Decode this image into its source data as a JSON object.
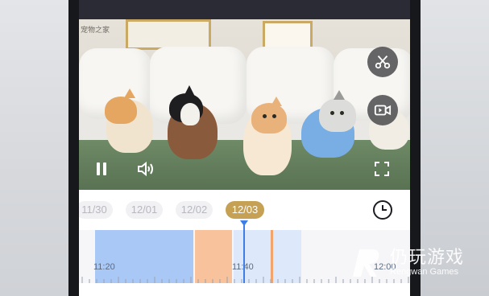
{
  "video": {
    "logo_text": "宠物之家",
    "controls": {
      "pause_icon": "pause-icon",
      "volume_icon": "volume-icon",
      "fullscreen_icon": "fullscreen-icon",
      "clip_icon": "scissors-icon",
      "record_icon": "video-record-icon"
    }
  },
  "dates": {
    "items": [
      {
        "label": "11/30",
        "active": false
      },
      {
        "label": "12/01",
        "active": false
      },
      {
        "label": "12/02",
        "active": false
      },
      {
        "label": "12/03",
        "active": true
      }
    ],
    "calendar_icon": "clock-icon"
  },
  "timeline": {
    "labels": [
      "11:20",
      "11:40",
      "12:00"
    ],
    "colors": {
      "blue": "#a9c8f6",
      "light_blue": "#dde9fb",
      "orange": "#f7c29c",
      "cursor": "#3f7ee8"
    }
  },
  "watermark": {
    "title": "仍玩游戏",
    "subtitle": "Rengwan Games"
  }
}
